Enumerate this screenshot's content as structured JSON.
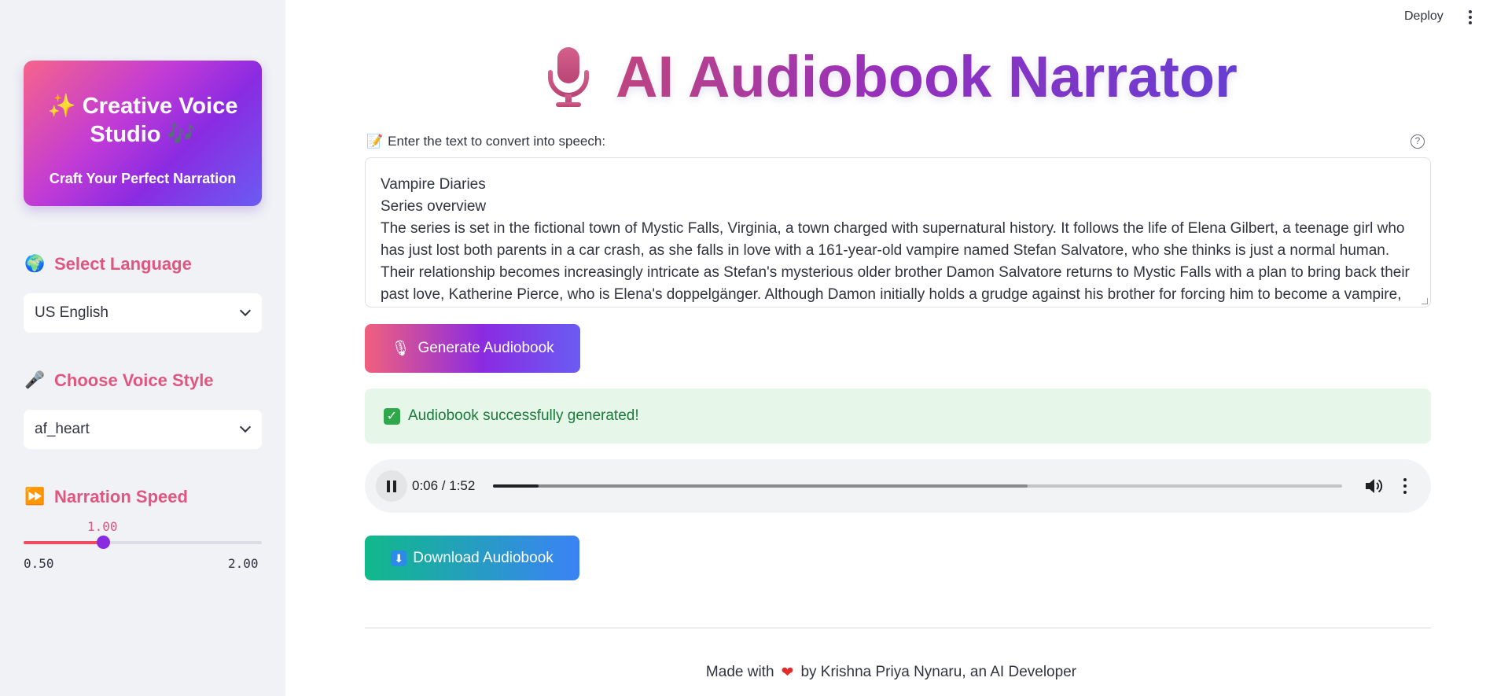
{
  "header": {
    "deploy_label": "Deploy",
    "menu_icon": "kebab-menu-icon"
  },
  "sidebar": {
    "brand": {
      "title_emoji": "✨",
      "title": "Creative Voice Studio",
      "title_end_emoji": "🎶",
      "subtitle": "Craft Your Perfect Narration"
    },
    "language": {
      "emoji": "🌍",
      "label": "Select Language",
      "value": "US English"
    },
    "voice": {
      "emoji": "🎤",
      "label": "Choose Voice Style",
      "value": "af_heart"
    },
    "speed": {
      "emoji": "⏩",
      "label": "Narration Speed",
      "value": "1.00",
      "value_num": 1.0,
      "min": "0.50",
      "max": "2.00",
      "min_num": 0.5,
      "max_num": 2.0
    }
  },
  "main": {
    "title_icon": "microphone-icon",
    "title": "AI Audiobook Narrator",
    "input_emoji": "📝",
    "input_label": "Enter the text to convert into speech:",
    "text_lines": [
      "Vampire Diaries",
      "Series overview",
      "The series is set in the fictional town of Mystic Falls, Virginia, a town charged with supernatural history. It follows the life of Elena Gilbert, a teenage girl who has just lost both parents in a car crash, as she falls in love with a 161-year-old vampire named Stefan Salvatore, who she thinks is just a normal human. Their relationship becomes increasingly intricate as Stefan's mysterious older brother Damon Salvatore returns to Mystic Falls with a plan to bring back their past love, Katherine Pierce, who is Elena's doppelgänger. Although Damon initially holds a grudge against his brother for forcing him to become a vampire, he"
    ],
    "generate_emoji": "🎙",
    "generate_label": "Generate Audiobook",
    "success_message": "Audiobook successfully generated!",
    "player": {
      "time": "0:06 / 1:52",
      "played_fraction": 0.054,
      "buffered_fraction": 0.63
    },
    "download_emoji": "⬇",
    "download_label": "Download Audiobook",
    "footer": {
      "prefix": "Made with",
      "suffix": "by Krishna Priya Nynaru, an AI Developer"
    }
  }
}
